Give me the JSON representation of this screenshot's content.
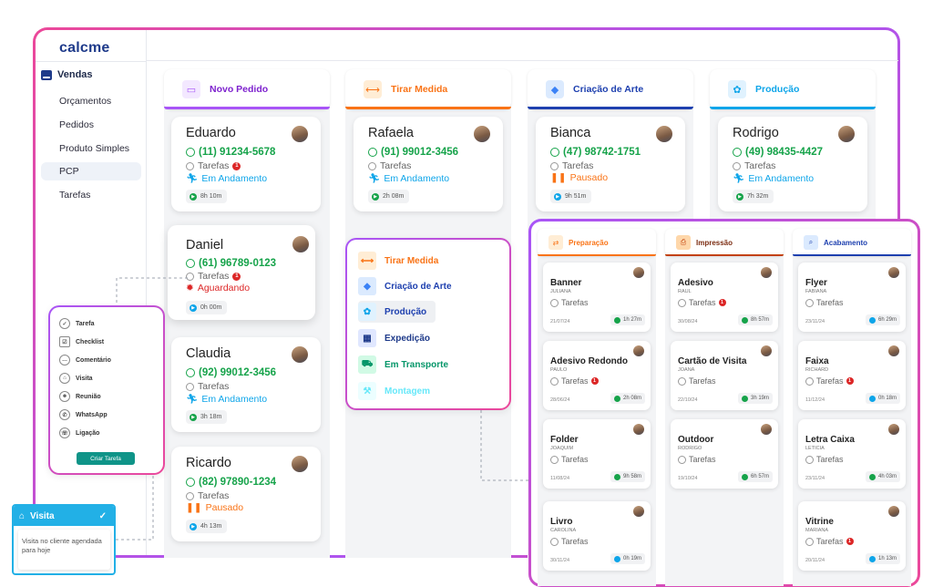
{
  "app": {
    "logo": "calcme"
  },
  "sidebar": {
    "section": "Vendas",
    "items": [
      {
        "label": "Orçamentos"
      },
      {
        "label": "Pedidos"
      },
      {
        "label": "Produto Simples"
      },
      {
        "label": "PCP"
      },
      {
        "label": "Tarefas"
      }
    ]
  },
  "columns": [
    {
      "title": "Novo Pedido",
      "color": "#a855f7"
    },
    {
      "title": "Tirar Medida",
      "color": "#f97316"
    },
    {
      "title": "Criação de Arte",
      "color": "#1e40af"
    },
    {
      "title": "Produção",
      "color": "#0ea5e9"
    }
  ],
  "cards": {
    "novo_pedido": [
      {
        "name": "Eduardo",
        "phone": "(11) 91234-5678",
        "tarefas": "Tarefas",
        "badge": "1",
        "status": "Em Andamento",
        "timer": "8h 10m"
      },
      {
        "name": "Daniel",
        "phone": "(61) 96789-0123",
        "tarefas": "Tarefas",
        "badge": "1",
        "status": "Aguardando",
        "timer": "0h 00m"
      },
      {
        "name": "Claudia",
        "phone": "(92) 99012-3456",
        "tarefas": "Tarefas",
        "status": "Em Andamento",
        "timer": "3h 18m"
      },
      {
        "name": "Ricardo",
        "phone": "(82) 97890-1234",
        "tarefas": "Tarefas",
        "status": "Pausado",
        "timer": "4h 13m"
      }
    ],
    "tirar_medida": [
      {
        "name": "Rafaela",
        "phone": "(91) 99012-3456",
        "tarefas": "Tarefas",
        "status": "Em Andamento",
        "timer": "2h 08m"
      }
    ],
    "criacao_arte": [
      {
        "name": "Bianca",
        "phone": "(47) 98742-1751",
        "tarefas": "Tarefas",
        "status": "Pausado",
        "timer": "9h 51m"
      }
    ],
    "producao": [
      {
        "name": "Rodrigo",
        "phone": "(49) 98435-4427",
        "tarefas": "Tarefas",
        "status": "Em Andamento",
        "timer": "7h 32m"
      }
    ]
  },
  "stage_menu": {
    "items": [
      {
        "label": "Tirar Medida",
        "color": "#f97316"
      },
      {
        "label": "Criação de Arte",
        "color": "#1e40af"
      },
      {
        "label": "Produção",
        "color": "#0ea5e9"
      },
      {
        "label": "Expedição",
        "color": "#1e3a8a"
      },
      {
        "label": "Em Transporte",
        "color": "#059669"
      },
      {
        "label": "Montagem",
        "color": "#67e8f9"
      }
    ]
  },
  "task_menu": {
    "items": [
      {
        "label": "Tarefa"
      },
      {
        "label": "Checklist"
      },
      {
        "label": "Comentário"
      },
      {
        "label": "Visita"
      },
      {
        "label": "Reunião"
      },
      {
        "label": "WhatsApp"
      },
      {
        "label": "Ligação"
      }
    ],
    "button": "Criar Tarefa"
  },
  "visita": {
    "title": "Visita",
    "check": "✓",
    "body": "Visita no cliente agendada para hoje"
  },
  "pcp": {
    "columns": [
      {
        "title": "Preparação",
        "color": "#f97316"
      },
      {
        "title": "Impressão",
        "color": "#c2410c"
      },
      {
        "title": "Acabamento",
        "color": "#1e40af"
      }
    ],
    "preparacao": [
      {
        "title": "Banner",
        "client": "JULIANA",
        "tarefas": "Tarefas",
        "date": "21/07/24",
        "time": "1h 27m"
      },
      {
        "title": "Adesivo Redondo",
        "client": "PAULO",
        "tarefas": "Tarefas",
        "badge": "1",
        "date": "28/06/24",
        "time": "2h 08m"
      },
      {
        "title": "Folder",
        "client": "JOAQUIM",
        "tarefas": "Tarefas",
        "date": "11/08/24",
        "time": "9h 58m"
      },
      {
        "title": "Livro",
        "client": "CAROLINA",
        "tarefas": "Tarefas",
        "date": "30/11/24",
        "time": "0h 19m"
      }
    ],
    "impressao": [
      {
        "title": "Adesivo",
        "client": "RAUL",
        "tarefas": "Tarefas",
        "badge": "1",
        "date": "30/08/24",
        "time": "8h 57m"
      },
      {
        "title": "Cartão de Visita",
        "client": "JOANA",
        "tarefas": "Tarefas",
        "date": "22/10/24",
        "time": "3h 19m"
      },
      {
        "title": "Outdoor",
        "client": "RODRIGO",
        "tarefas": "Tarefas",
        "date": "19/10/24",
        "time": "6h 57m"
      }
    ],
    "acabamento": [
      {
        "title": "Flyer",
        "client": "FABIANA",
        "tarefas": "Tarefas",
        "date": "23/11/24",
        "time": "6h 29m"
      },
      {
        "title": "Faixa",
        "client": "RICHARD",
        "tarefas": "Tarefas",
        "badge": "1",
        "date": "11/12/24",
        "time": "0h 18m"
      },
      {
        "title": "Letra Caixa",
        "client": "LETICIA",
        "tarefas": "Tarefas",
        "date": "23/11/24",
        "time": "4h 03m"
      },
      {
        "title": "Vitrine",
        "client": "MARIANA",
        "tarefas": "Tarefas",
        "badge": "1",
        "date": "20/11/24",
        "time": "1h 13m"
      }
    ]
  }
}
